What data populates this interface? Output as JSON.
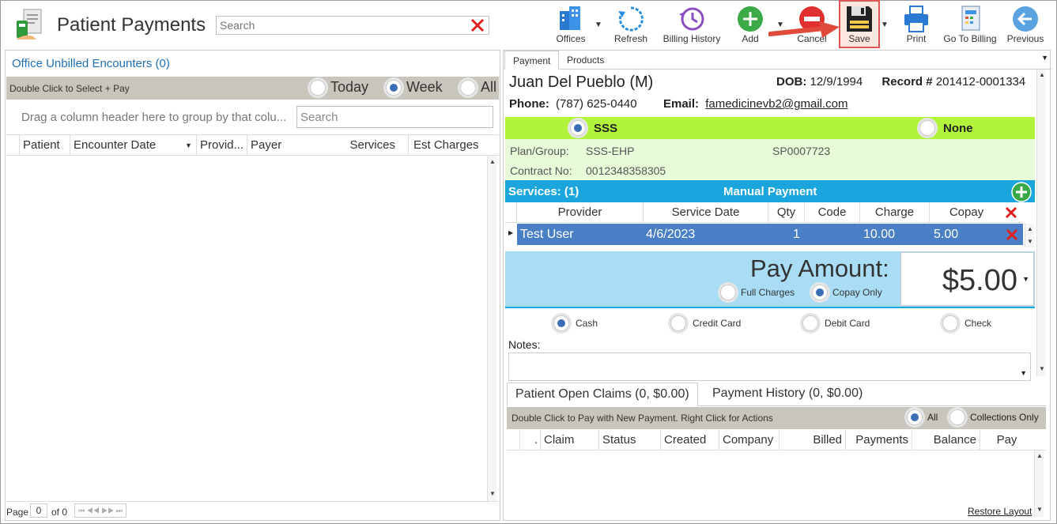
{
  "header": {
    "title": "Patient Payments",
    "search_placeholder": "Search"
  },
  "toolbar": {
    "offices": "Offices",
    "refresh": "Refresh",
    "billing_history": "Billing History",
    "add": "Add",
    "cancel": "Cancel",
    "save": "Save",
    "print": "Print",
    "go_to_billing": "Go To Billing",
    "previous": "Previous"
  },
  "left": {
    "title": "Office Unbilled Encounters (0)",
    "hint": "Double Click to Select + Pay",
    "filters": [
      {
        "label": "Today",
        "selected": false
      },
      {
        "label": "Week",
        "selected": true
      },
      {
        "label": "All",
        "selected": false
      }
    ],
    "group_hint": "Drag a column header here to group by that colu...",
    "search_placeholder": "Search",
    "columns": [
      "Patient",
      "Encounter Date",
      "Provid...",
      "Payer",
      "Services",
      "Est Charges"
    ],
    "pager": {
      "page_label": "Page",
      "page": "0",
      "of": "of 0"
    }
  },
  "right": {
    "tabs": [
      "Payment",
      "Products"
    ],
    "patient": {
      "name": "Juan Del Pueblo",
      "sex": "(M)",
      "dob_label": "DOB:",
      "dob": "12/9/1994",
      "record_label": "Record #",
      "record": "201412-0001334",
      "phone_label": "Phone:",
      "phone": "(787) 625-0440",
      "email_label": "Email:",
      "email": "famedicinevb2@gmail.com"
    },
    "insurance": {
      "option1": "SSS",
      "option2": "None",
      "plan_label": "Plan/Group:",
      "plan": "SSS-EHP",
      "group": "SP0007723",
      "contract_label": "Contract No:",
      "contract": "0012348358305"
    },
    "services": {
      "title": "Services: (1)",
      "mode": "Manual Payment",
      "columns": [
        "Provider",
        "Service Date",
        "Qty",
        "Code",
        "Charge",
        "Copay"
      ],
      "rows": [
        {
          "provider": "Test User",
          "date": "4/6/2023",
          "qty": "1",
          "code": "",
          "charge": "10.00",
          "copay": "5.00"
        }
      ]
    },
    "pay": {
      "label": "Pay Amount:",
      "amount": "$5.00",
      "full_charges": "Full Charges",
      "copay_only": "Copay Only"
    },
    "methods": [
      "Cash",
      "Credit Card",
      "Debit Card",
      "Check"
    ],
    "notes_label": "Notes:",
    "bottom_tabs": [
      "Patient Open Claims (0, $0.00)",
      "Payment History (0, $0.00)"
    ],
    "claims_hint": "Double Click to Pay with New Payment. Right Click for Actions",
    "claims_filter_all": "All",
    "claims_filter_collections": "Collections Only",
    "claims_columns": [
      ".",
      "Claim",
      "Status",
      "Created",
      "Company",
      "Billed",
      "Payments",
      "Balance",
      "Pay"
    ],
    "restore_layout": "Restore Layout"
  },
  "colors": {
    "green_bar": "#b2f43c",
    "blue_bar": "#1aa5dc",
    "selected_row": "#4a7fc6",
    "pay_band": "#a9ddf5"
  }
}
